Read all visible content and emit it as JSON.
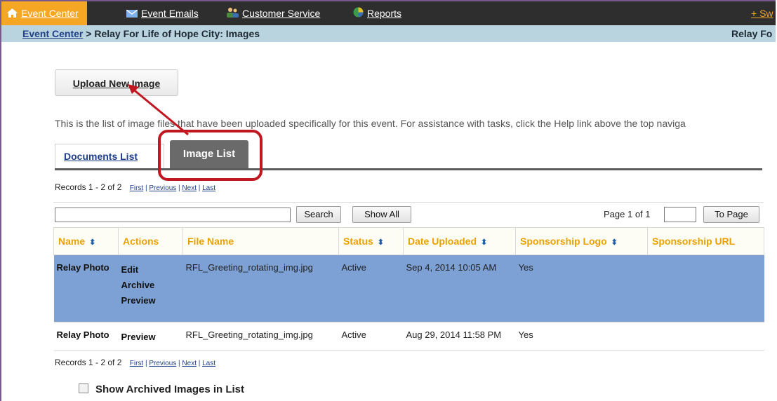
{
  "nav": {
    "items": [
      {
        "label": "Event Center",
        "icon": "home-icon"
      },
      {
        "label": "Event Emails",
        "icon": "mail-icon"
      },
      {
        "label": "Customer Service",
        "icon": "people-icon"
      },
      {
        "label": "Reports",
        "icon": "chart-icon"
      }
    ],
    "right_label": "+ Sw"
  },
  "breadcrumb": {
    "root": "Event Center",
    "separator": " > ",
    "current": "Relay For Life of Hope City: Images",
    "right": "Relay Fo"
  },
  "upload_button": "Upload New Image",
  "description": "This is the list of image files that have been uploaded specifically for this event. For assistance with tasks, click the Help link above the top naviga",
  "tabs": {
    "documents": "Documents List",
    "images": "Image List"
  },
  "records": {
    "summary": "Records 1 - 2 of 2",
    "first": "First",
    "previous": "Previous",
    "next": "Next",
    "last": "Last",
    "sep": " | "
  },
  "toolbar": {
    "search_label": "Search",
    "show_all_label": "Show All",
    "page_label": "Page 1 of 1",
    "to_page_label": "To Page"
  },
  "table": {
    "columns": [
      "Name",
      "Actions",
      "File Name",
      "Status",
      "Date Uploaded",
      "Sponsorship Logo",
      "Sponsorship URL"
    ],
    "sort_icon": "⬍",
    "rows": [
      {
        "name": "Relay Photo",
        "actions": [
          "Edit",
          "Archive",
          "Preview"
        ],
        "file_name": "RFL_Greeting_rotating_img.jpg",
        "status": "Active",
        "date": "Sep 4, 2014 10:05 AM",
        "logo": "Yes",
        "url": ""
      },
      {
        "name": "Relay Photo",
        "actions": [
          "Preview"
        ],
        "file_name": "RFL_Greeting_rotating_img.jpg",
        "status": "Active",
        "date": "Aug 29, 2014 11:58 PM",
        "logo": "Yes",
        "url": ""
      }
    ]
  },
  "show_archived_label": "Show Archived Images in List",
  "colors": {
    "nav_bg": "#2e2e2e",
    "nav_active": "#f5a623",
    "breadcrumb_bg": "#b9d3df",
    "selected_row": "#7da1d4",
    "annotation": "#c01820",
    "header_text": "#e8a200"
  }
}
